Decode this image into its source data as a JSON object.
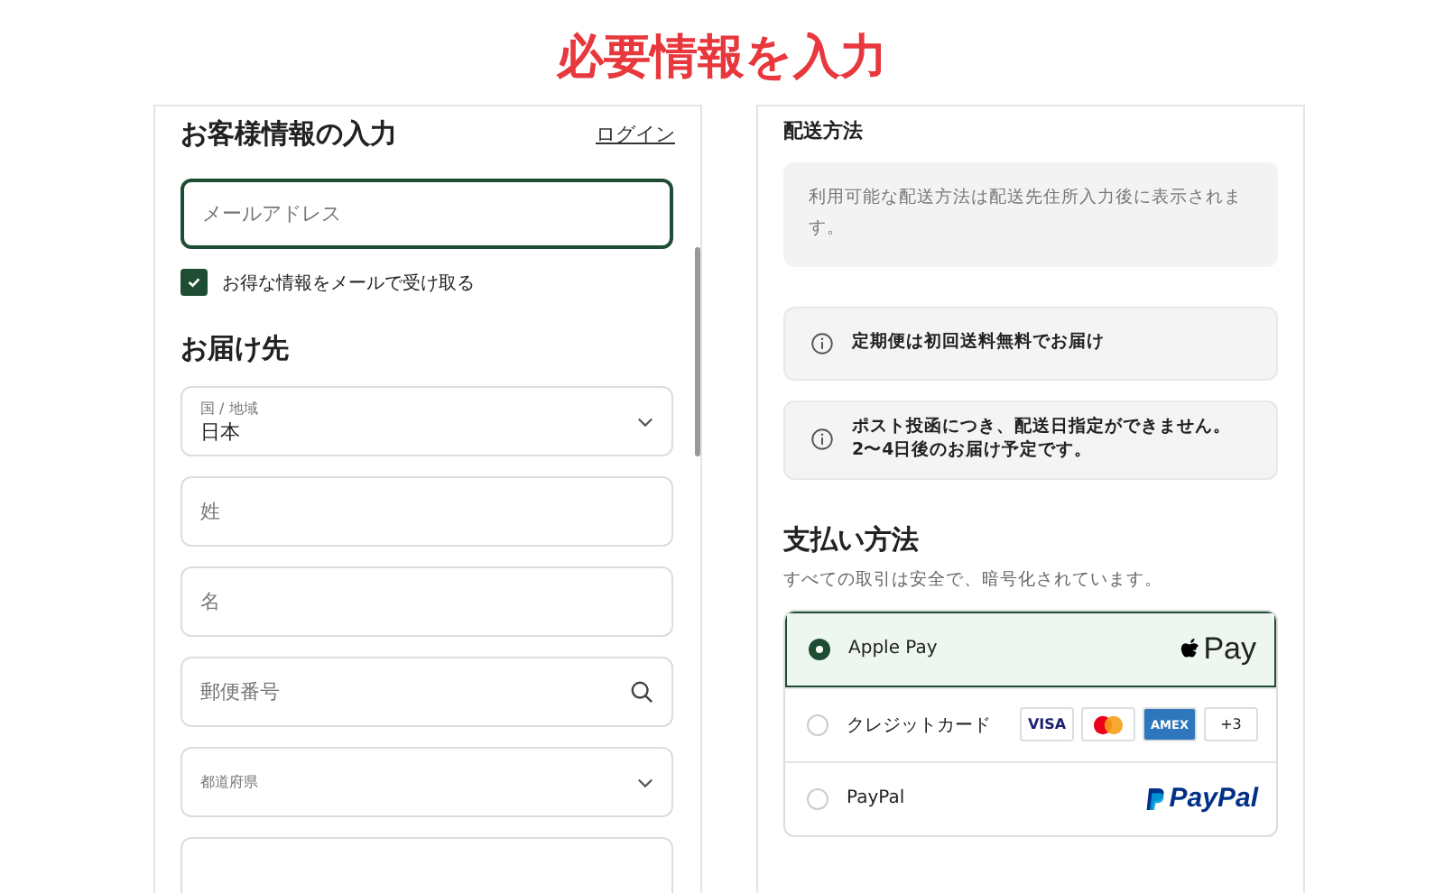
{
  "page_title": "必要情報を入力",
  "customer": {
    "heading": "お客様情報の入力",
    "login_link": "ログイン",
    "email": {
      "placeholder": "メールアドレス",
      "focused": true
    },
    "newsletter": {
      "label": "お得な情報をメールで受け取る",
      "checked": true
    }
  },
  "delivery": {
    "heading": "お届け先",
    "fields": [
      {
        "kind": "select",
        "label": "国 / 地域",
        "value": "日本"
      },
      {
        "kind": "text",
        "placeholder": "姓"
      },
      {
        "kind": "text",
        "placeholder": "名"
      },
      {
        "kind": "search",
        "placeholder": "郵便番号"
      },
      {
        "kind": "select",
        "label": "都道府県"
      },
      {
        "kind": "text"
      }
    ]
  },
  "shipping": {
    "heading": "配送方法",
    "note": "利用可能な配送方法は配送先住所入力後に表示されます。",
    "notices": [
      "定期便は初回送料無料でお届け",
      "ポスト投函につき、配送日指定ができません。\n2〜4日後のお届け予定です。"
    ]
  },
  "payment": {
    "heading": "支払い方法",
    "subtitle": "すべての取引は安全で、暗号化されています。",
    "methods": [
      {
        "kind": "apple",
        "label": "Apple Pay",
        "selected": true,
        "logo_text": "Pay"
      },
      {
        "kind": "cards",
        "label": "クレジットカード",
        "selected": false,
        "cards": [
          "VISA",
          "AMEX"
        ],
        "more": "+3"
      },
      {
        "kind": "paypal",
        "label": "PayPal",
        "selected": false,
        "logo_text": "PayPal"
      }
    ]
  }
}
